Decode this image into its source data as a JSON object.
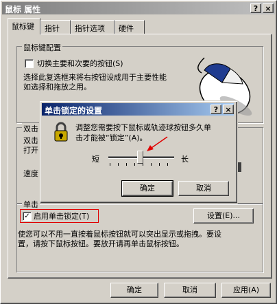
{
  "window": {
    "title": "鼠标 属性",
    "help_btn": "?",
    "close_btn": "×"
  },
  "tabs": [
    {
      "label": "鼠标键",
      "selected": true
    },
    {
      "label": "指针",
      "selected": false
    },
    {
      "label": "指针选项",
      "selected": false
    },
    {
      "label": "硬件",
      "selected": false
    }
  ],
  "button_config": {
    "group_label": "鼠标键配置",
    "switch_label": "切换主要和次要的按钮(S)",
    "switch_checked": false,
    "desc_line1": "选择此复选框来将右按钮设成用于主要性能",
    "desc_line2": "如选择和拖放之用。"
  },
  "double_click": {
    "group_label_partial": "双击",
    "desc_line1": "双击",
    "desc_line2": "打开",
    "speed_label": "速度"
  },
  "click_lock": {
    "group_label_partial": "单击",
    "enable_label": "启用单击锁定(T)",
    "enable_checked": true,
    "check_mark": "✓",
    "settings_button": "设置(E)...",
    "desc_line1": "使您可以不用一直按着鼠标按钮就可以突出显示或拖拽。要设",
    "desc_line2": "置，请按下鼠标按钮。要放开请再单击鼠标按钮。"
  },
  "dialog": {
    "title": "单击锁定的设置",
    "help_btn": "?",
    "close_btn": "×",
    "desc_line1": "调整您需要按下鼠标或轨迹球按钮多久单",
    "desc_line2": "击才能被“锁定”(A)。",
    "short_label": "短",
    "long_label": "长",
    "slider_value_fraction": 0.48,
    "ok": "确定",
    "cancel": "取消"
  },
  "footer": {
    "ok": "确定",
    "cancel": "取消",
    "apply": "应用(A)"
  },
  "colors": {
    "face": "#d4d0c8",
    "active_title": "#0a246a",
    "inactive_title": "#808080",
    "highlight": "#e00000"
  }
}
